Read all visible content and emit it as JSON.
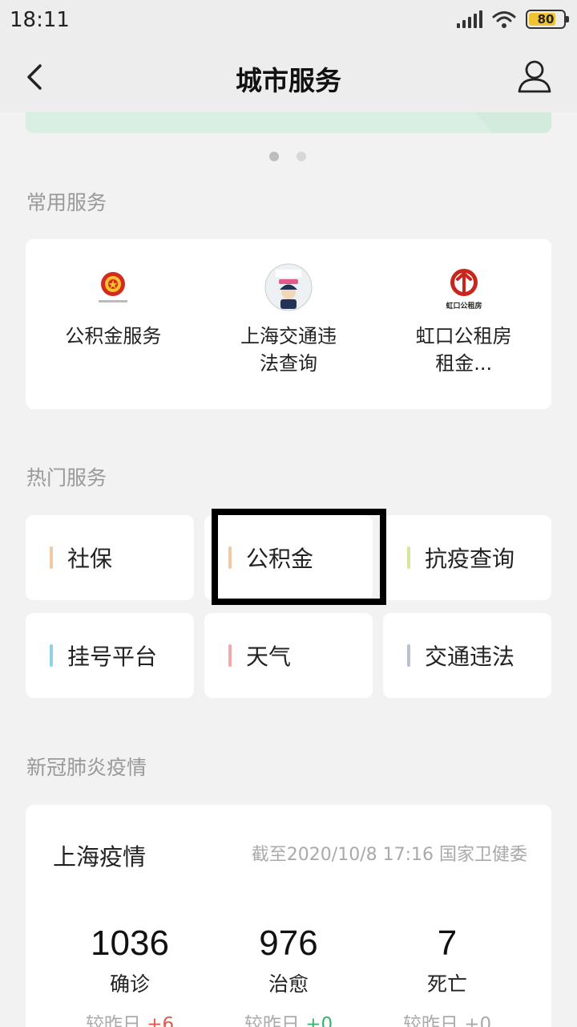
{
  "status_bar": {
    "time": "18:11",
    "battery": "80",
    "battery_level": 0.8
  },
  "nav": {
    "title": "城市服务"
  },
  "carousel": {
    "pages": 2,
    "active_page": 1
  },
  "common_services": {
    "title": "常用服务",
    "items": [
      {
        "label": "公积金服务",
        "icon": "national-emblem-icon"
      },
      {
        "label": "上海交通违法查询",
        "icon": "traffic-police-icon"
      },
      {
        "label": "虹口公租房租金...",
        "icon": "hongkou-housing-icon",
        "icon_text": "虹口公租房"
      }
    ]
  },
  "hot_services": {
    "title": "热门服务",
    "items": [
      {
        "label": "社保",
        "color": "#f4c9a0"
      },
      {
        "label": "公积金",
        "color": "#f4c9a0"
      },
      {
        "label": "抗疫查询",
        "color": "#d3e89a"
      },
      {
        "label": "挂号平台",
        "color": "#8fd0ea"
      },
      {
        "label": "天气",
        "color": "#f0a9a9"
      },
      {
        "label": "交通违法",
        "color": "#b9c0cf"
      }
    ]
  },
  "covid": {
    "section_title": "新冠肺炎疫情",
    "card_title": "上海疫情",
    "source": "截至2020/10/8 17:16 国家卫健委",
    "delta_prefix": "较昨日",
    "stats": [
      {
        "value": "1036",
        "label": "确诊",
        "delta": "+6"
      },
      {
        "value": "976",
        "label": "治愈",
        "delta": "+0"
      },
      {
        "value": "7",
        "label": "死亡",
        "delta": "+0"
      }
    ]
  }
}
